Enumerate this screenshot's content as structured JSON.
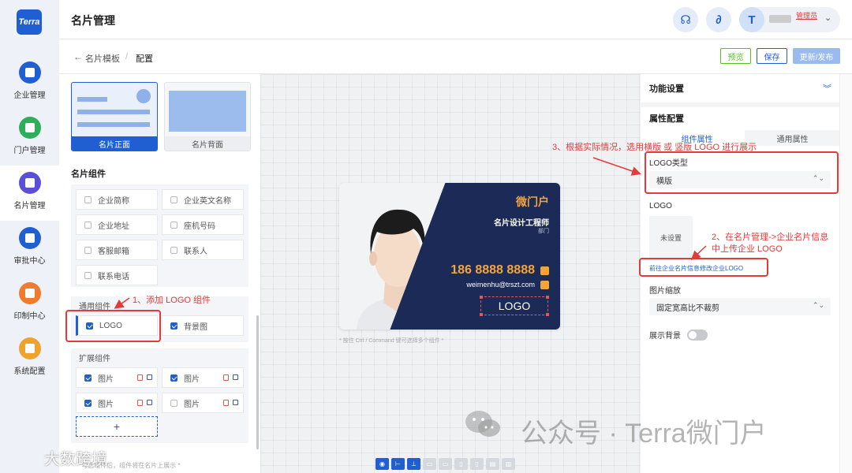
{
  "app": {
    "logo_text": "Terra",
    "page_title": "名片管理"
  },
  "nav": {
    "items": [
      {
        "label": "企业管理",
        "icon": "building-icon",
        "color": "#1f5fd1"
      },
      {
        "label": "门户管理",
        "icon": "portal-icon",
        "color": "#2dae5b"
      },
      {
        "label": "名片管理",
        "icon": "card-icon",
        "color": "#5b4fd8"
      },
      {
        "label": "审批中心",
        "icon": "approval-icon",
        "color": "#1f5fd1"
      },
      {
        "label": "印制中心",
        "icon": "print-icon",
        "color": "#f07b2c"
      },
      {
        "label": "系统配置",
        "icon": "settings-icon",
        "color": "#f0a32c"
      }
    ],
    "active_index": 2
  },
  "user": {
    "role": "管理员"
  },
  "breadcrumb": {
    "parent": "名片模板",
    "separator": "/",
    "current": "配置"
  },
  "actions": {
    "preview": "预览",
    "save": "保存",
    "publish": "更新/发布"
  },
  "templates": {
    "front": "名片正面",
    "back": "名片背面"
  },
  "components": {
    "title": "名片组件",
    "basic_items": [
      {
        "label": "企业简称",
        "checked": false
      },
      {
        "label": "企业英文名称",
        "checked": false
      },
      {
        "label": "企业地址",
        "checked": false
      },
      {
        "label": "座机号码",
        "checked": false
      },
      {
        "label": "客服邮箱",
        "checked": false
      },
      {
        "label": "联系人",
        "checked": false
      },
      {
        "label": "联系电话",
        "checked": false
      }
    ],
    "common_title": "通用组件",
    "common_items": [
      {
        "label": "LOGO",
        "checked": true
      },
      {
        "label": "背景图",
        "checked": true
      }
    ],
    "ext_title": "扩展组件",
    "ext_items": [
      {
        "label": "图片",
        "checked": true
      },
      {
        "label": "图片",
        "checked": true
      },
      {
        "label": "图片",
        "checked": true
      },
      {
        "label": "图片",
        "checked": false
      }
    ],
    "add_label": "+",
    "bottom_hint": "*勾选组件后，组件将在名片上展示 *"
  },
  "card": {
    "company": "微门户",
    "title": "名片设计工程师",
    "dept": "部门",
    "phone": "186 8888 8888",
    "email": "weimenhu@trszt.com",
    "logo": "LOGO",
    "hint": "* 按住 Ctrl / Command 键可选择多个组件 *"
  },
  "right": {
    "func_title": "功能设置",
    "attr_title": "属性配置",
    "tabs": [
      "组件属性",
      "通用属性"
    ],
    "logo_type_label": "LOGO类型",
    "logo_type_value": "横版",
    "logo_label": "LOGO",
    "upload_text": "未设置",
    "link_text": "前往企业名片信息修改企业LOGO",
    "scale_label": "图片缩放",
    "scale_value": "固定宽高比不裁剪",
    "bg_label": "展示背景"
  },
  "annotations": {
    "a1": "1、添加 LOGO 组件",
    "a2_line1": "2、在名片管理->企业名片信息",
    "a2_line2": "中上传企业 LOGO",
    "a3": "3、根据实际情况，选用横版 或 竖版 LOGO 进行展示"
  },
  "watermark": {
    "wechat": "公众号 · Terra微门户",
    "corner": "大数跨境"
  }
}
